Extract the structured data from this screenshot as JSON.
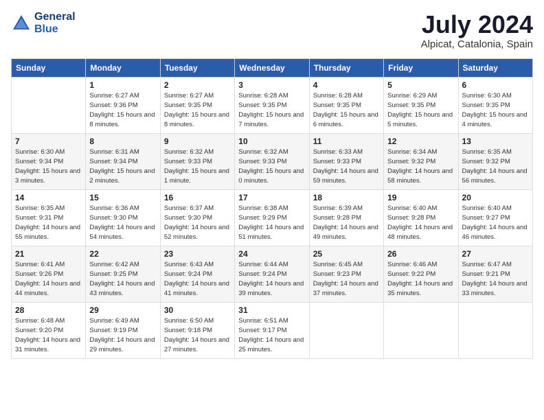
{
  "header": {
    "logo_line1": "General",
    "logo_line2": "Blue",
    "month": "July 2024",
    "location": "Alpicat, Catalonia, Spain"
  },
  "weekdays": [
    "Sunday",
    "Monday",
    "Tuesday",
    "Wednesday",
    "Thursday",
    "Friday",
    "Saturday"
  ],
  "weeks": [
    [
      {
        "day": "",
        "sunrise": "",
        "sunset": "",
        "daylight": ""
      },
      {
        "day": "1",
        "sunrise": "Sunrise: 6:27 AM",
        "sunset": "Sunset: 9:36 PM",
        "daylight": "Daylight: 15 hours and 8 minutes."
      },
      {
        "day": "2",
        "sunrise": "Sunrise: 6:27 AM",
        "sunset": "Sunset: 9:35 PM",
        "daylight": "Daylight: 15 hours and 8 minutes."
      },
      {
        "day": "3",
        "sunrise": "Sunrise: 6:28 AM",
        "sunset": "Sunset: 9:35 PM",
        "daylight": "Daylight: 15 hours and 7 minutes."
      },
      {
        "day": "4",
        "sunrise": "Sunrise: 6:28 AM",
        "sunset": "Sunset: 9:35 PM",
        "daylight": "Daylight: 15 hours and 6 minutes."
      },
      {
        "day": "5",
        "sunrise": "Sunrise: 6:29 AM",
        "sunset": "Sunset: 9:35 PM",
        "daylight": "Daylight: 15 hours and 5 minutes."
      },
      {
        "day": "6",
        "sunrise": "Sunrise: 6:30 AM",
        "sunset": "Sunset: 9:35 PM",
        "daylight": "Daylight: 15 hours and 4 minutes."
      }
    ],
    [
      {
        "day": "7",
        "sunrise": "Sunrise: 6:30 AM",
        "sunset": "Sunset: 9:34 PM",
        "daylight": "Daylight: 15 hours and 3 minutes."
      },
      {
        "day": "8",
        "sunrise": "Sunrise: 6:31 AM",
        "sunset": "Sunset: 9:34 PM",
        "daylight": "Daylight: 15 hours and 2 minutes."
      },
      {
        "day": "9",
        "sunrise": "Sunrise: 6:32 AM",
        "sunset": "Sunset: 9:33 PM",
        "daylight": "Daylight: 15 hours and 1 minute."
      },
      {
        "day": "10",
        "sunrise": "Sunrise: 6:32 AM",
        "sunset": "Sunset: 9:33 PM",
        "daylight": "Daylight: 15 hours and 0 minutes."
      },
      {
        "day": "11",
        "sunrise": "Sunrise: 6:33 AM",
        "sunset": "Sunset: 9:33 PM",
        "daylight": "Daylight: 14 hours and 59 minutes."
      },
      {
        "day": "12",
        "sunrise": "Sunrise: 6:34 AM",
        "sunset": "Sunset: 9:32 PM",
        "daylight": "Daylight: 14 hours and 58 minutes."
      },
      {
        "day": "13",
        "sunrise": "Sunrise: 6:35 AM",
        "sunset": "Sunset: 9:32 PM",
        "daylight": "Daylight: 14 hours and 56 minutes."
      }
    ],
    [
      {
        "day": "14",
        "sunrise": "Sunrise: 6:35 AM",
        "sunset": "Sunset: 9:31 PM",
        "daylight": "Daylight: 14 hours and 55 minutes."
      },
      {
        "day": "15",
        "sunrise": "Sunrise: 6:36 AM",
        "sunset": "Sunset: 9:30 PM",
        "daylight": "Daylight: 14 hours and 54 minutes."
      },
      {
        "day": "16",
        "sunrise": "Sunrise: 6:37 AM",
        "sunset": "Sunset: 9:30 PM",
        "daylight": "Daylight: 14 hours and 52 minutes."
      },
      {
        "day": "17",
        "sunrise": "Sunrise: 6:38 AM",
        "sunset": "Sunset: 9:29 PM",
        "daylight": "Daylight: 14 hours and 51 minutes."
      },
      {
        "day": "18",
        "sunrise": "Sunrise: 6:39 AM",
        "sunset": "Sunset: 9:28 PM",
        "daylight": "Daylight: 14 hours and 49 minutes."
      },
      {
        "day": "19",
        "sunrise": "Sunrise: 6:40 AM",
        "sunset": "Sunset: 9:28 PM",
        "daylight": "Daylight: 14 hours and 48 minutes."
      },
      {
        "day": "20",
        "sunrise": "Sunrise: 6:40 AM",
        "sunset": "Sunset: 9:27 PM",
        "daylight": "Daylight: 14 hours and 46 minutes."
      }
    ],
    [
      {
        "day": "21",
        "sunrise": "Sunrise: 6:41 AM",
        "sunset": "Sunset: 9:26 PM",
        "daylight": "Daylight: 14 hours and 44 minutes."
      },
      {
        "day": "22",
        "sunrise": "Sunrise: 6:42 AM",
        "sunset": "Sunset: 9:25 PM",
        "daylight": "Daylight: 14 hours and 43 minutes."
      },
      {
        "day": "23",
        "sunrise": "Sunrise: 6:43 AM",
        "sunset": "Sunset: 9:24 PM",
        "daylight": "Daylight: 14 hours and 41 minutes."
      },
      {
        "day": "24",
        "sunrise": "Sunrise: 6:44 AM",
        "sunset": "Sunset: 9:24 PM",
        "daylight": "Daylight: 14 hours and 39 minutes."
      },
      {
        "day": "25",
        "sunrise": "Sunrise: 6:45 AM",
        "sunset": "Sunset: 9:23 PM",
        "daylight": "Daylight: 14 hours and 37 minutes."
      },
      {
        "day": "26",
        "sunrise": "Sunrise: 6:46 AM",
        "sunset": "Sunset: 9:22 PM",
        "daylight": "Daylight: 14 hours and 35 minutes."
      },
      {
        "day": "27",
        "sunrise": "Sunrise: 6:47 AM",
        "sunset": "Sunset: 9:21 PM",
        "daylight": "Daylight: 14 hours and 33 minutes."
      }
    ],
    [
      {
        "day": "28",
        "sunrise": "Sunrise: 6:48 AM",
        "sunset": "Sunset: 9:20 PM",
        "daylight": "Daylight: 14 hours and 31 minutes."
      },
      {
        "day": "29",
        "sunrise": "Sunrise: 6:49 AM",
        "sunset": "Sunset: 9:19 PM",
        "daylight": "Daylight: 14 hours and 29 minutes."
      },
      {
        "day": "30",
        "sunrise": "Sunrise: 6:50 AM",
        "sunset": "Sunset: 9:18 PM",
        "daylight": "Daylight: 14 hours and 27 minutes."
      },
      {
        "day": "31",
        "sunrise": "Sunrise: 6:51 AM",
        "sunset": "Sunset: 9:17 PM",
        "daylight": "Daylight: 14 hours and 25 minutes."
      },
      {
        "day": "",
        "sunrise": "",
        "sunset": "",
        "daylight": ""
      },
      {
        "day": "",
        "sunrise": "",
        "sunset": "",
        "daylight": ""
      },
      {
        "day": "",
        "sunrise": "",
        "sunset": "",
        "daylight": ""
      }
    ]
  ]
}
